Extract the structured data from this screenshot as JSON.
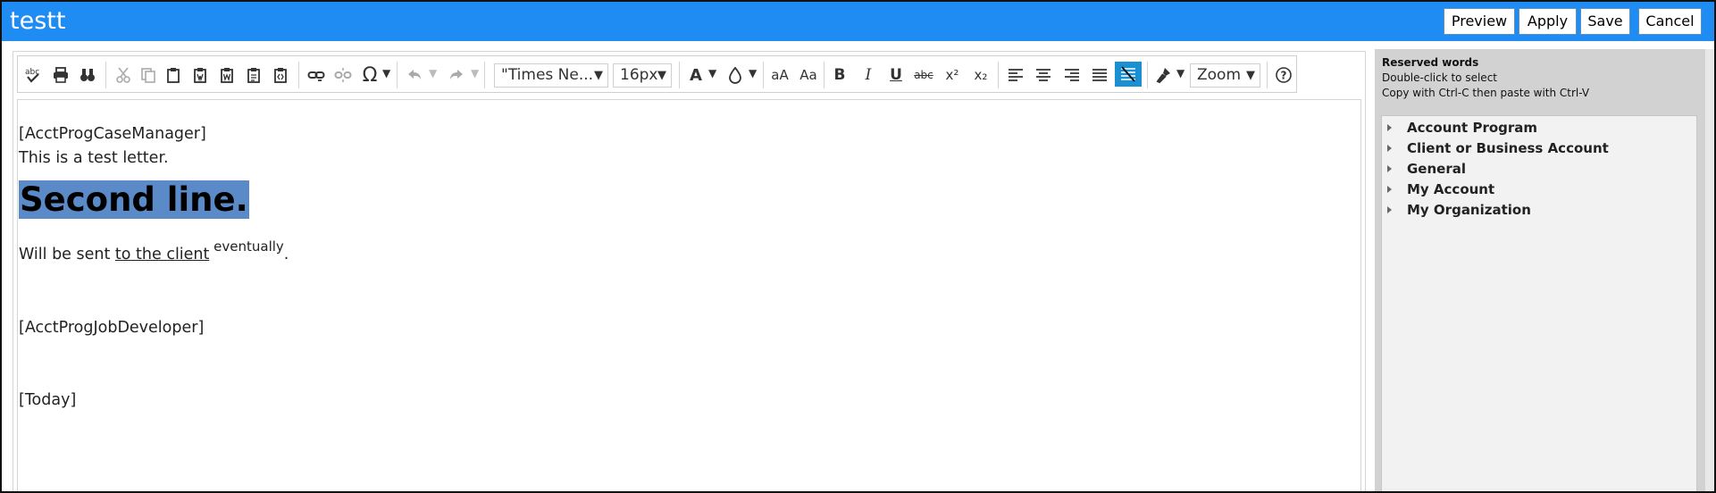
{
  "window": {
    "title": "testt"
  },
  "actions": {
    "preview": "Preview",
    "apply": "Apply",
    "save": "Save",
    "cancel": "Cancel"
  },
  "toolbar": {
    "font_family": "\"Times Ne...",
    "font_size": "16px",
    "zoom": "Zoom",
    "text_case_lower": "aA",
    "text_case_title": "Aa",
    "bold": "B",
    "italic": "I",
    "underline": "U",
    "strike": "abc",
    "superscript": "x²",
    "subscript": "x₂",
    "omega": "Ω",
    "font_color": "A",
    "help": "?"
  },
  "document": {
    "line1": "[AcctProgCaseManager]",
    "line2": "This is a test letter.",
    "heading": "Second line.",
    "line3_before": "Will be sent ",
    "line3_underlined": "to the client",
    "line3_sup": " eventually",
    "line3_after": ".",
    "line4": "[AcctProgJobDeveloper]",
    "line5": "[Today]"
  },
  "panel": {
    "title": "Reserved words",
    "hint1": "Double-click to select",
    "hint2": "Copy with Ctrl-C then paste with Ctrl-V",
    "items": [
      {
        "label": "Account Program"
      },
      {
        "label": "Client or Business Account"
      },
      {
        "label": "General"
      },
      {
        "label": "My Account"
      },
      {
        "label": "My Organization"
      }
    ]
  },
  "colors": {
    "titlebar": "#1e8cf3",
    "selection": "#5b8ac8",
    "active_tool": "#1a8fd1"
  }
}
